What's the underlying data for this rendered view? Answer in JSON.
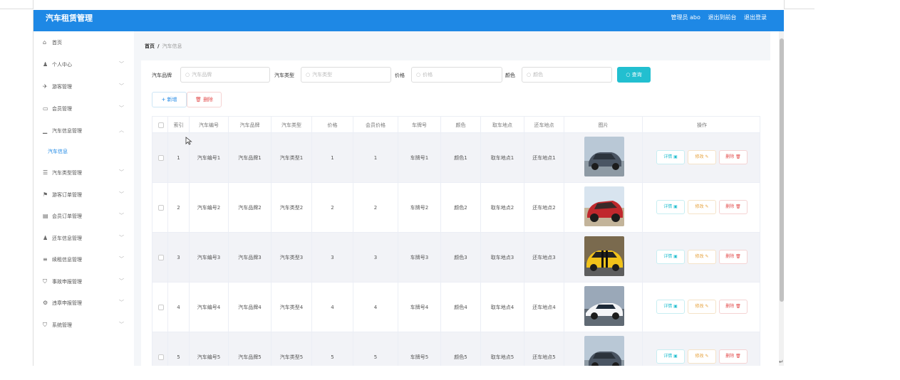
{
  "header": {
    "app_title": "汽车租赁管理",
    "admin_label": "管理员 abo",
    "back_label": "退出到前台",
    "logout_label": "退出登录"
  },
  "sidebar": {
    "items": [
      {
        "label": "首页",
        "icon": "home-icon",
        "chev": ""
      },
      {
        "label": "个人中心",
        "icon": "user-icon",
        "chev": "﹀"
      },
      {
        "label": "游客管理",
        "icon": "send-icon",
        "chev": "﹀"
      },
      {
        "label": "会员管理",
        "icon": "card-icon",
        "chev": "﹀"
      },
      {
        "label": "汽车信息管理",
        "icon": "chart-icon",
        "chev": "︿"
      },
      {
        "label": "汽车类型管理",
        "icon": "list-icon",
        "chev": "﹀"
      },
      {
        "label": "游客订单管理",
        "icon": "flag-icon",
        "chev": "﹀"
      },
      {
        "label": "会员订单管理",
        "icon": "doc-icon",
        "chev": "﹀"
      },
      {
        "label": "还车信息管理",
        "icon": "user-icon",
        "chev": "﹀"
      },
      {
        "label": "续租信息管理",
        "icon": "menu-icon",
        "chev": "﹀"
      },
      {
        "label": "事故申报管理",
        "icon": "shield-icon",
        "chev": "﹀"
      },
      {
        "label": "违章申报管理",
        "icon": "settings-icon",
        "chev": "﹀"
      },
      {
        "label": "系统管理",
        "icon": "shield-icon",
        "chev": "﹀"
      }
    ],
    "sub_item": "汽车信息"
  },
  "breadcrumb": {
    "home": "首页",
    "separator": "/",
    "current": "汽车信息"
  },
  "search": {
    "brand_label": "汽车品牌",
    "brand_placeholder": "汽车品牌",
    "type_label": "汽车类型",
    "type_placeholder": "汽车类型",
    "price_label": "价格",
    "price_placeholder": "价格",
    "color_label": "颜色",
    "color_placeholder": "颜色",
    "query_label": "查询"
  },
  "toolbar": {
    "add_label": "+ 新增",
    "delete_label": "删除"
  },
  "table": {
    "headers": [
      "索引",
      "汽车编号",
      "汽车品牌",
      "汽车类型",
      "价格",
      "会员价格",
      "车牌号",
      "颜色",
      "取车地点",
      "还车地点",
      "图片",
      "操作"
    ],
    "rows": [
      {
        "index": "1",
        "code": "汽车编号1",
        "brand": "汽车品牌1",
        "type": "汽车类型1",
        "price": "1",
        "member_price": "1",
        "plate": "车牌号1",
        "color": "颜色1",
        "pickup": "取车地点1",
        "return": "还车地点1"
      },
      {
        "index": "2",
        "code": "汽车编号2",
        "brand": "汽车品牌2",
        "type": "汽车类型2",
        "price": "2",
        "member_price": "2",
        "plate": "车牌号2",
        "color": "颜色2",
        "pickup": "取车地点2",
        "return": "还车地点2"
      },
      {
        "index": "3",
        "code": "汽车编号3",
        "brand": "汽车品牌3",
        "type": "汽车类型3",
        "price": "3",
        "member_price": "3",
        "plate": "车牌号3",
        "color": "颜色3",
        "pickup": "取车地点3",
        "return": "还车地点3"
      },
      {
        "index": "4",
        "code": "汽车编号4",
        "brand": "汽车品牌4",
        "type": "汽车类型4",
        "price": "4",
        "member_price": "4",
        "plate": "车牌号4",
        "color": "颜色4",
        "pickup": "取车地点4",
        "return": "还车地点4"
      },
      {
        "index": "5",
        "code": "汽车编号5",
        "brand": "汽车品牌5",
        "type": "汽车类型5",
        "price": "5",
        "member_price": "5",
        "plate": "车牌号5",
        "color": "颜色5",
        "pickup": "取车地点5",
        "return": "还车地点5"
      }
    ],
    "actions": {
      "detail": "详情",
      "edit": "修改",
      "delete": "删除"
    }
  },
  "colors": {
    "primary": "#1e88e5",
    "query": "#22bfd0",
    "danger": "#e34b4b",
    "warning": "#e6a23c"
  }
}
